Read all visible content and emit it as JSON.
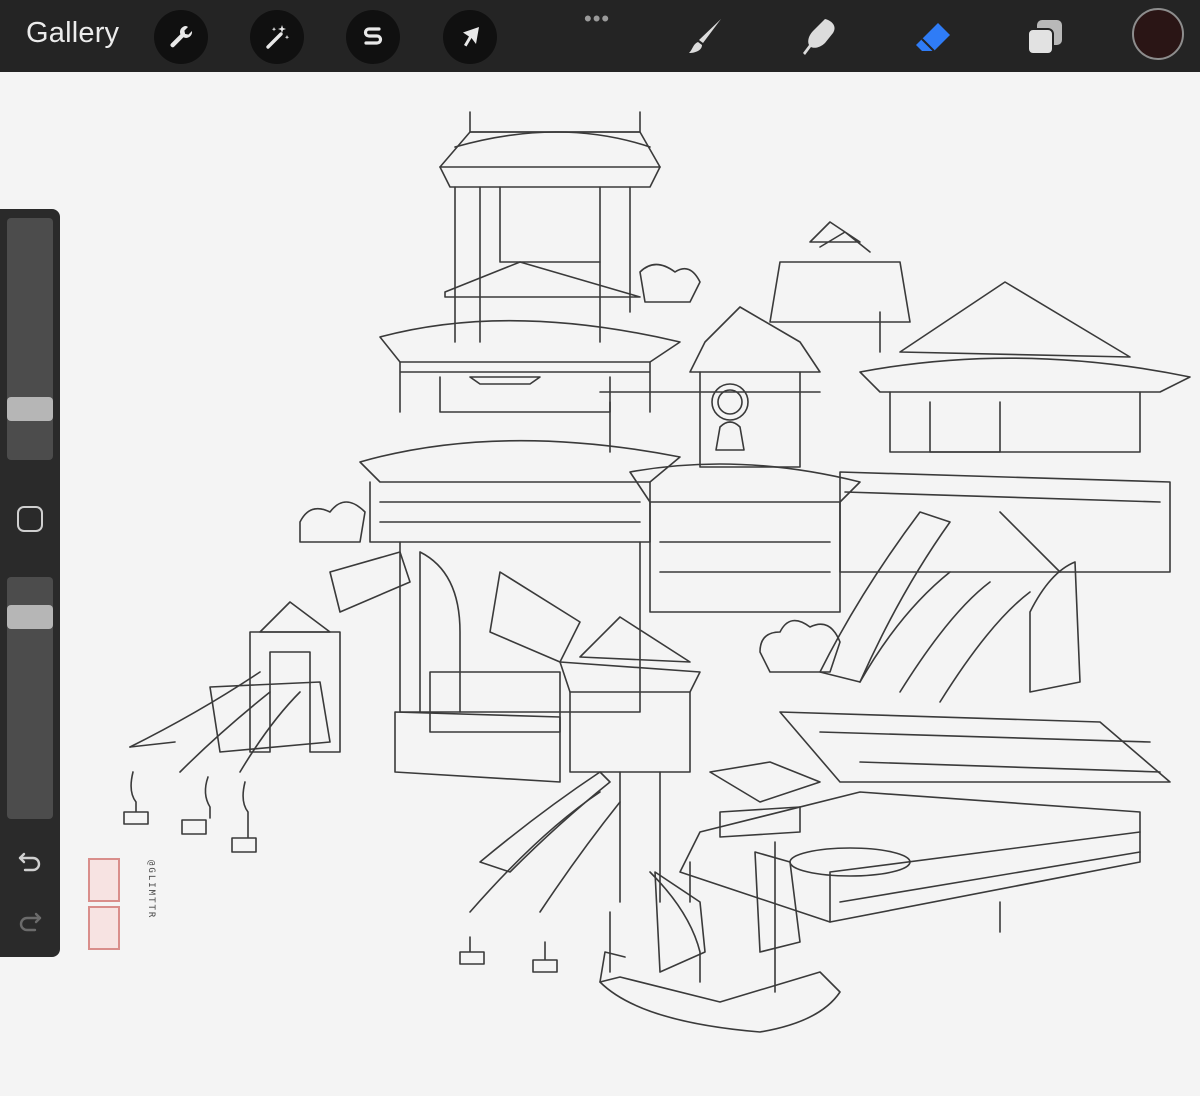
{
  "toolbar": {
    "gallery_label": "Gallery",
    "left_tools": [
      {
        "name": "actions",
        "icon": "wrench-icon"
      },
      {
        "name": "adjustments",
        "icon": "magic-wand-icon"
      },
      {
        "name": "selection",
        "icon": "selection-s-icon"
      },
      {
        "name": "transform",
        "icon": "arrow-cursor-icon"
      }
    ],
    "more_label": "•••",
    "right_tools": [
      {
        "name": "brush",
        "icon": "brush-icon",
        "active": false
      },
      {
        "name": "smudge",
        "icon": "smudge-icon",
        "active": false
      },
      {
        "name": "eraser",
        "icon": "eraser-icon",
        "active": true
      },
      {
        "name": "layers",
        "icon": "layers-icon",
        "active": false
      }
    ],
    "active_color": "#2a1515",
    "accent_color": "#2f7cf6"
  },
  "sidebar": {
    "brush_size": 0.18,
    "brush_opacity": 0.87,
    "undo_icon": "undo-icon",
    "redo_icon": "redo-icon",
    "modifier_icon": "square-modifier-icon"
  },
  "artwork": {
    "subject": "line drawing of Asian pagoda-style buildings with banners and a sailing junk",
    "signature_handle": "@GLIMTTR",
    "stamp_color": "#d98e8b"
  }
}
